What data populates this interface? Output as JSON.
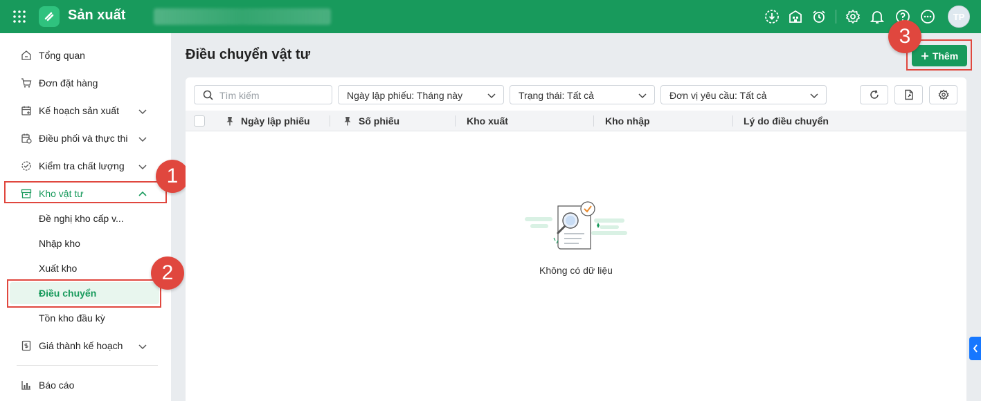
{
  "header": {
    "app_title": "Sản xuất",
    "avatar_initials": "TP",
    "brand_color": "#189a5c",
    "icons": [
      "apps-grid-icon",
      "download-icon",
      "building-icon",
      "alarm-clock-icon",
      "gear-icon",
      "bell-icon",
      "help-icon",
      "more-icon"
    ]
  },
  "sidebar": {
    "items": [
      {
        "label": "Tổng quan",
        "icon": "home-icon"
      },
      {
        "label": "Đơn đặt hàng",
        "icon": "cart-icon"
      },
      {
        "label": "Kế hoạch sản xuất",
        "icon": "calendar-plan-icon"
      },
      {
        "label": "Điều phối và thực thi",
        "icon": "calendar-clock-icon"
      },
      {
        "label": "Kiểm tra chất lượng",
        "icon": "quality-check-icon"
      },
      {
        "label": "Kho vật tư",
        "icon": "warehouse-box-icon"
      },
      {
        "label": "Giá thành kế hoạch",
        "icon": "cost-icon"
      },
      {
        "label": "Báo cáo",
        "icon": "chart-icon"
      }
    ],
    "sub_items": [
      {
        "label": "Đề nghị kho cấp v..."
      },
      {
        "label": "Nhập kho"
      },
      {
        "label": "Xuất kho"
      },
      {
        "label": "Điều chuyển"
      },
      {
        "label": "Tồn kho đầu kỳ"
      }
    ]
  },
  "main": {
    "page_title": "Điều chuyển vật tư",
    "add_button_label": "Thêm",
    "filters": {
      "search_placeholder": "Tìm kiếm",
      "date_filter": "Ngày lập phiếu: Tháng này",
      "status_filter": "Trạng thái: Tất cả",
      "unit_filter": "Đơn vị yêu cầu: Tất cả"
    },
    "table": {
      "columns": [
        "Ngày lập phiếu",
        "Số phiếu",
        "Kho xuất",
        "Kho nhập",
        "Lý do điều chuyển"
      ],
      "rows": []
    },
    "empty_text": "Không có dữ liệu"
  },
  "annotations": {
    "step1": "1",
    "step2": "2",
    "step3": "3",
    "color": "#e0473e"
  }
}
